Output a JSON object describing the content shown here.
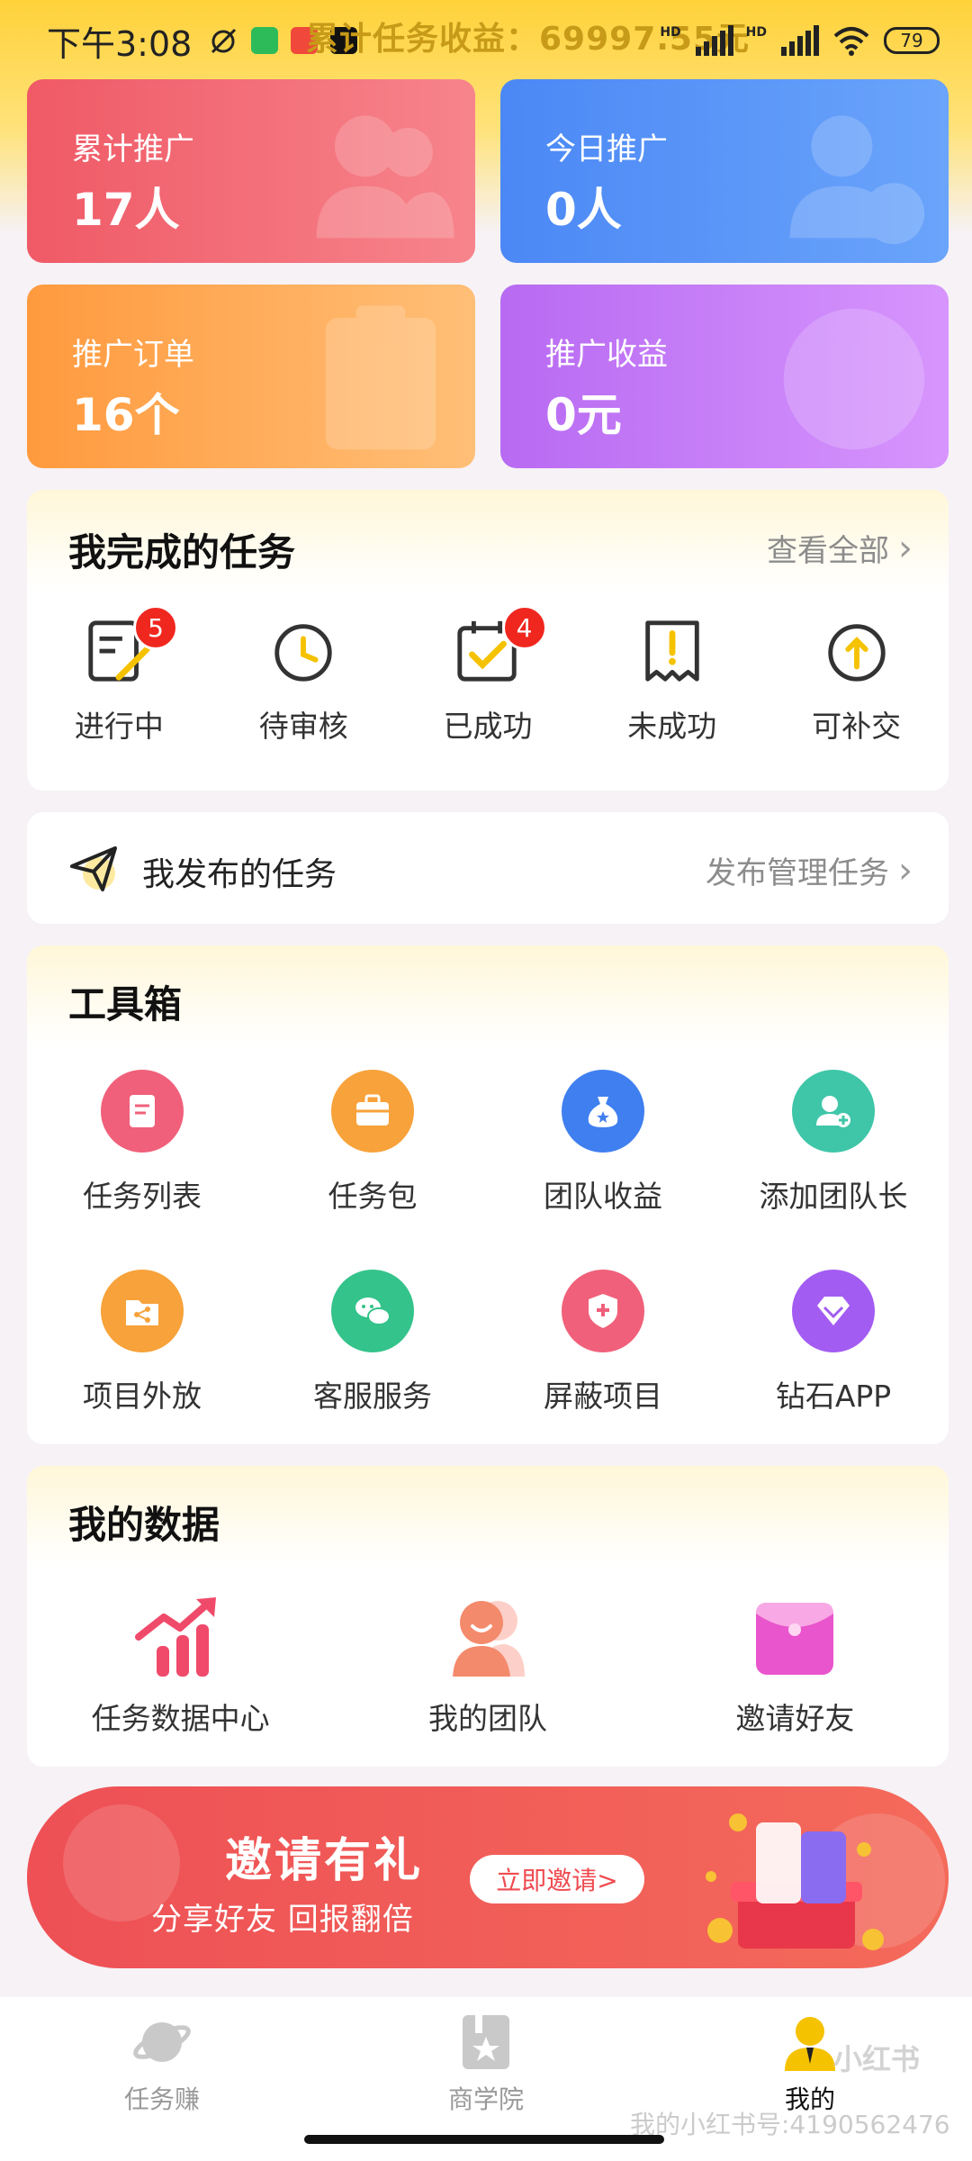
{
  "status_bar": {
    "time": "下午3:08",
    "banner": "累计任务收益：69997.55元",
    "battery": "79",
    "hd1": "HD",
    "hd2": "HD"
  },
  "stats": [
    {
      "label": "累计推广",
      "value": "17人",
      "color": "#ef5a66"
    },
    {
      "label": "今日推广",
      "value": "0人",
      "color": "#4b88f5"
    },
    {
      "label": "推广订单",
      "value": "16个",
      "color": "#ff9a3e"
    },
    {
      "label": "推广收益",
      "value": "0元",
      "color": "#b86af2"
    }
  ],
  "completed_tasks": {
    "title": "我完成的任务",
    "link": "查看全部",
    "items": [
      {
        "label": "进行中",
        "badge": "5",
        "icon": "in-progress-icon"
      },
      {
        "label": "待审核",
        "badge": "",
        "icon": "clock-icon"
      },
      {
        "label": "已成功",
        "badge": "4",
        "icon": "calendar-check-icon"
      },
      {
        "label": "未成功",
        "badge": "",
        "icon": "receipt-alert-icon"
      },
      {
        "label": "可补交",
        "badge": "",
        "icon": "upload-circle-icon"
      }
    ]
  },
  "published": {
    "title": "我发布的任务",
    "link": "发布管理任务"
  },
  "toolbox": {
    "title": "工具箱",
    "items": [
      {
        "label": "任务列表",
        "icon": "document-icon",
        "color": "#f0607a"
      },
      {
        "label": "任务包",
        "icon": "briefcase-icon",
        "color": "#f7a23a"
      },
      {
        "label": "团队收益",
        "icon": "money-bag-icon",
        "color": "#3f7ff0"
      },
      {
        "label": "添加团队长",
        "icon": "add-user-icon",
        "color": "#3fc6a8"
      },
      {
        "label": "项目外放",
        "icon": "share-folder-icon",
        "color": "#f7a23a"
      },
      {
        "label": "客服服务",
        "icon": "wechat-icon",
        "color": "#34c38a"
      },
      {
        "label": "屏蔽项目",
        "icon": "shield-plus-icon",
        "color": "#f0607a"
      },
      {
        "label": "钻石APP",
        "icon": "diamond-icon",
        "color": "#a35cf2"
      }
    ]
  },
  "my_data": {
    "title": "我的数据",
    "items": [
      {
        "label": "任务数据中心",
        "icon": "growth-chart-icon"
      },
      {
        "label": "我的团队",
        "icon": "team-icon"
      },
      {
        "label": "邀请好友",
        "icon": "envelope-icon"
      }
    ]
  },
  "invite_banner": {
    "title": "邀请有礼",
    "subtitle": "分享好友 回报翻倍",
    "button": "立即邀请>"
  },
  "bottom_nav": [
    {
      "label": "任务赚",
      "icon": "planet-icon",
      "active": false
    },
    {
      "label": "商学院",
      "icon": "book-star-icon",
      "active": false
    },
    {
      "label": "我的",
      "icon": "profile-icon",
      "active": true
    }
  ],
  "watermark": {
    "text": "我的小红书号:4190562476",
    "logo": "小红书"
  }
}
